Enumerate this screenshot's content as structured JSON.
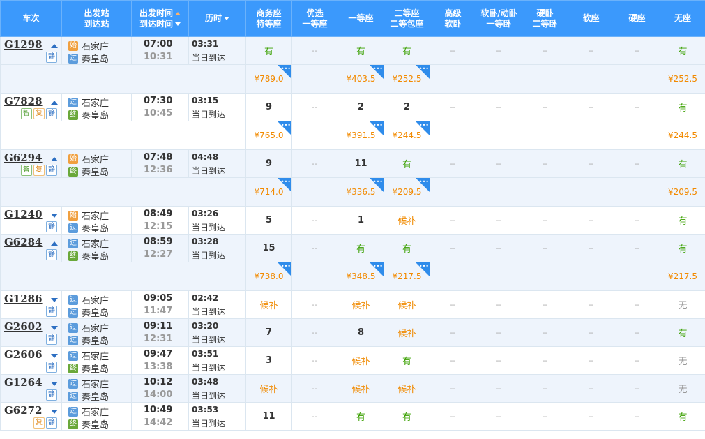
{
  "header": {
    "train_no": "车次",
    "station": [
      "出发站",
      "到达站"
    ],
    "time": [
      "出发时间",
      "到达时间"
    ],
    "duration": "历时",
    "seats": [
      [
        "商务座",
        "特等座"
      ],
      [
        "优选",
        "一等座"
      ],
      [
        "一等座"
      ],
      [
        "二等座",
        "二等包座"
      ],
      [
        "高级",
        "软卧"
      ],
      [
        "软卧/动卧",
        "一等卧"
      ],
      [
        "硬卧",
        "二等卧"
      ],
      [
        "软座"
      ],
      [
        "硬座"
      ],
      [
        "无座"
      ]
    ]
  },
  "trains": [
    {
      "no": "G1298",
      "dir": "up",
      "tags": [
        {
          "t": "静",
          "c": "blue"
        }
      ],
      "from": {
        "badge": "始",
        "name": "石家庄",
        "type": "start"
      },
      "to": {
        "badge": "过",
        "name": "秦皇岛",
        "type": "pass"
      },
      "dep": "07:00",
      "arr": "10:31",
      "dur": "03:31",
      "day": "当日到达",
      "seats": [
        "有",
        "--",
        "有",
        "有",
        "--",
        "--",
        "--",
        "--",
        "--",
        "有"
      ],
      "prices": [
        "¥789.0",
        "",
        "¥403.5",
        "¥252.5",
        "",
        "",
        "",
        "",
        "",
        "¥252.5"
      ],
      "band": true
    },
    {
      "no": "G7828",
      "dir": "up",
      "tags": [
        {
          "t": "智",
          "c": "green"
        },
        {
          "t": "复",
          "c": "orange"
        },
        {
          "t": "静",
          "c": "blue"
        }
      ],
      "from": {
        "badge": "过",
        "name": "石家庄",
        "type": "pass"
      },
      "to": {
        "badge": "终",
        "name": "秦皇岛",
        "type": "end"
      },
      "dep": "07:30",
      "arr": "10:45",
      "dur": "03:15",
      "day": "当日到达",
      "seats": [
        "9",
        "--",
        "2",
        "2",
        "--",
        "--",
        "--",
        "--",
        "--",
        "有"
      ],
      "prices": [
        "¥765.0",
        "",
        "¥391.5",
        "¥244.5",
        "",
        "",
        "",
        "",
        "",
        "¥244.5"
      ],
      "band": false
    },
    {
      "no": "G6294",
      "dir": "up",
      "tags": [
        {
          "t": "智",
          "c": "green"
        },
        {
          "t": "复",
          "c": "orange"
        },
        {
          "t": "静",
          "c": "blue"
        }
      ],
      "from": {
        "badge": "始",
        "name": "石家庄",
        "type": "start"
      },
      "to": {
        "badge": "终",
        "name": "秦皇岛",
        "type": "end"
      },
      "dep": "07:48",
      "arr": "12:36",
      "dur": "04:48",
      "day": "当日到达",
      "seats": [
        "9",
        "--",
        "11",
        "有",
        "--",
        "--",
        "--",
        "--",
        "--",
        "有"
      ],
      "prices": [
        "¥714.0",
        "",
        "¥336.5",
        "¥209.5",
        "",
        "",
        "",
        "",
        "",
        "¥209.5"
      ],
      "band": true
    },
    {
      "no": "G1240",
      "dir": "down",
      "tags": [
        {
          "t": "静",
          "c": "blue"
        }
      ],
      "from": {
        "badge": "始",
        "name": "石家庄",
        "type": "start"
      },
      "to": {
        "badge": "过",
        "name": "秦皇岛",
        "type": "pass"
      },
      "dep": "08:49",
      "arr": "12:15",
      "dur": "03:26",
      "day": "当日到达",
      "seats": [
        "5",
        "--",
        "1",
        "候补",
        "--",
        "--",
        "--",
        "--",
        "--",
        "有"
      ],
      "prices": null,
      "band": false
    },
    {
      "no": "G6284",
      "dir": "up",
      "tags": [
        {
          "t": "静",
          "c": "blue"
        }
      ],
      "from": {
        "badge": "过",
        "name": "石家庄",
        "type": "pass"
      },
      "to": {
        "badge": "终",
        "name": "秦皇岛",
        "type": "end"
      },
      "dep": "08:59",
      "arr": "12:27",
      "dur": "03:28",
      "day": "当日到达",
      "seats": [
        "15",
        "--",
        "有",
        "有",
        "--",
        "--",
        "--",
        "--",
        "--",
        "有"
      ],
      "prices": [
        "¥738.0",
        "",
        "¥348.5",
        "¥217.5",
        "",
        "",
        "",
        "",
        "",
        "¥217.5"
      ],
      "band": true
    },
    {
      "no": "G1286",
      "dir": "down",
      "tags": [
        {
          "t": "静",
          "c": "blue"
        }
      ],
      "from": {
        "badge": "过",
        "name": "石家庄",
        "type": "pass"
      },
      "to": {
        "badge": "过",
        "name": "秦皇岛",
        "type": "pass"
      },
      "dep": "09:05",
      "arr": "11:47",
      "dur": "02:42",
      "day": "当日到达",
      "seats": [
        "候补",
        "--",
        "候补",
        "候补",
        "--",
        "--",
        "--",
        "--",
        "--",
        "无"
      ],
      "prices": null,
      "band": false
    },
    {
      "no": "G2602",
      "dir": "down",
      "tags": [
        {
          "t": "静",
          "c": "blue"
        }
      ],
      "from": {
        "badge": "过",
        "name": "石家庄",
        "type": "pass"
      },
      "to": {
        "badge": "过",
        "name": "秦皇岛",
        "type": "pass"
      },
      "dep": "09:11",
      "arr": "12:31",
      "dur": "03:20",
      "day": "当日到达",
      "seats": [
        "7",
        "--",
        "8",
        "候补",
        "--",
        "--",
        "--",
        "--",
        "--",
        "有"
      ],
      "prices": null,
      "band": true
    },
    {
      "no": "G2606",
      "dir": "down",
      "tags": [
        {
          "t": "静",
          "c": "blue"
        }
      ],
      "from": {
        "badge": "过",
        "name": "石家庄",
        "type": "pass"
      },
      "to": {
        "badge": "终",
        "name": "秦皇岛",
        "type": "end"
      },
      "dep": "09:47",
      "arr": "13:38",
      "dur": "03:51",
      "day": "当日到达",
      "seats": [
        "3",
        "--",
        "候补",
        "有",
        "--",
        "--",
        "--",
        "--",
        "--",
        "无"
      ],
      "prices": null,
      "band": false
    },
    {
      "no": "G1264",
      "dir": "down",
      "tags": [
        {
          "t": "静",
          "c": "blue"
        }
      ],
      "from": {
        "badge": "过",
        "name": "石家庄",
        "type": "pass"
      },
      "to": {
        "badge": "过",
        "name": "秦皇岛",
        "type": "pass"
      },
      "dep": "10:12",
      "arr": "14:00",
      "dur": "03:48",
      "day": "当日到达",
      "seats": [
        "候补",
        "--",
        "候补",
        "候补",
        "--",
        "--",
        "--",
        "--",
        "--",
        "无"
      ],
      "prices": null,
      "band": true
    },
    {
      "no": "G6272",
      "dir": "down",
      "tags": [
        {
          "t": "复",
          "c": "orange"
        },
        {
          "t": "静",
          "c": "blue"
        }
      ],
      "from": {
        "badge": "过",
        "name": "石家庄",
        "type": "pass"
      },
      "to": {
        "badge": "终",
        "name": "秦皇岛",
        "type": "end"
      },
      "dep": "10:49",
      "arr": "14:42",
      "dur": "03:53",
      "day": "当日到达",
      "seats": [
        "11",
        "--",
        "有",
        "有",
        "--",
        "--",
        "--",
        "--",
        "--",
        "有"
      ],
      "prices": null,
      "band": false
    }
  ]
}
